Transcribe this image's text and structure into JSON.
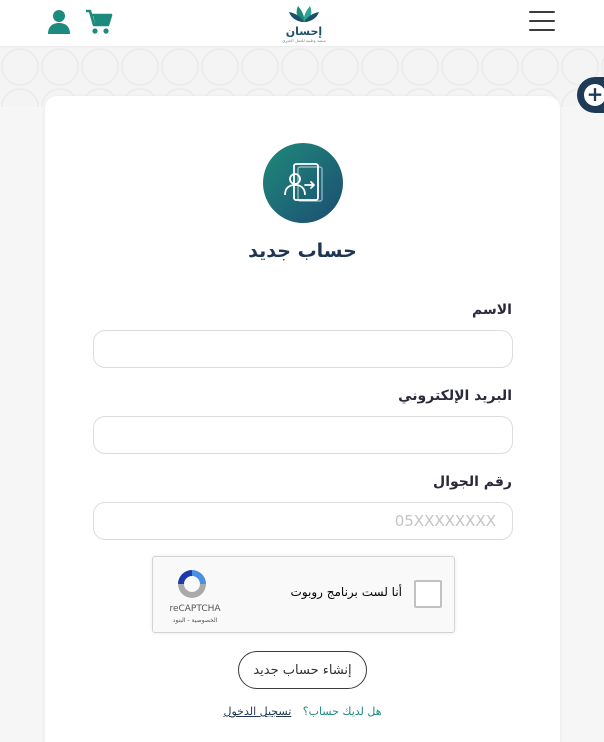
{
  "header": {
    "logo_text": "إحسان",
    "logo_subtitle": "منصة وطنية للعمل الخيري",
    "icons": [
      "user-icon",
      "cart-icon",
      "menu-icon"
    ]
  },
  "floating": {
    "icon": "plus-icon"
  },
  "form": {
    "title": "حساب جديد",
    "name_label": "الاسم",
    "name_value": "",
    "email_label": "البريد الإلكتروني",
    "email_value": "",
    "phone_label": "رقم الجوال",
    "phone_value": "",
    "phone_placeholder": "05XXXXXXXX",
    "submit_label": "إنشاء حساب جديد",
    "have_account": "هل لديك حساب؟",
    "login_link": "تسجيل الدخول"
  },
  "recaptcha": {
    "label": "أنا لست برنامج روبوت",
    "brand": "reCAPTCHA",
    "links": "الخصوصية - البنود"
  },
  "colors": {
    "brand_teal": "#1d8a7e",
    "brand_navy": "#1e3552"
  }
}
